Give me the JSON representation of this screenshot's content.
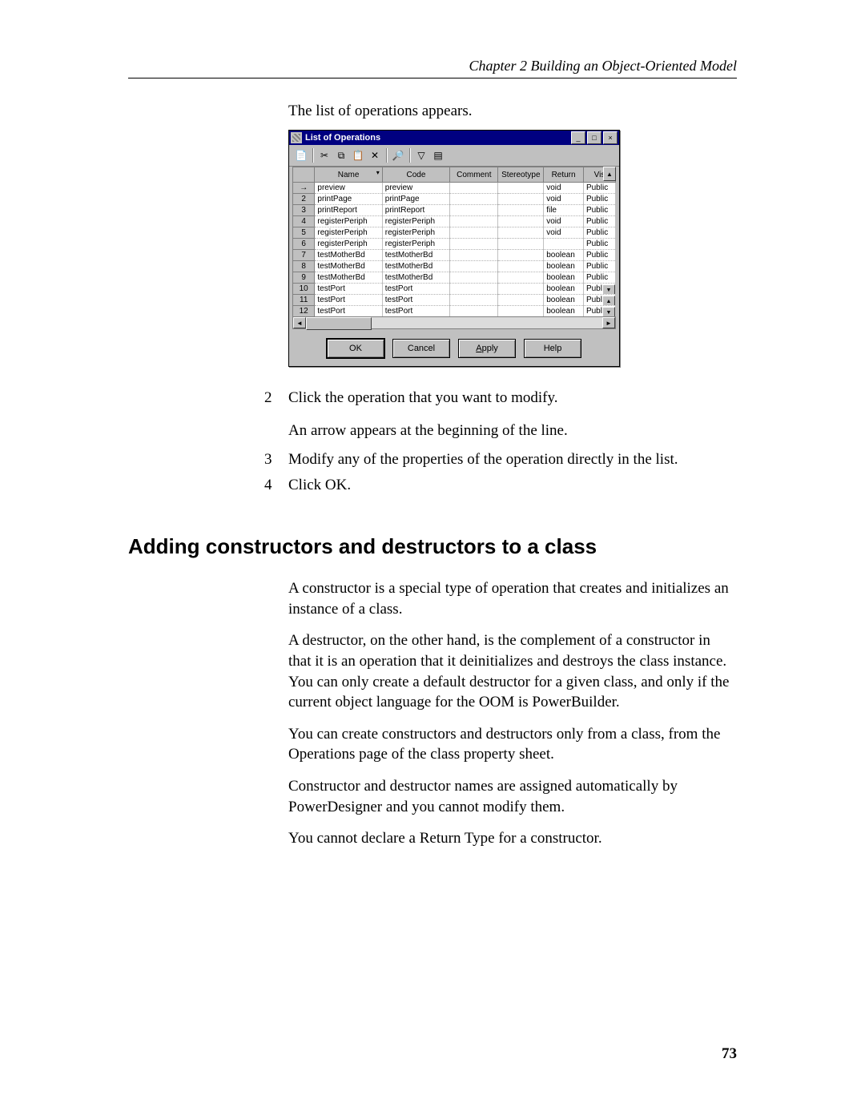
{
  "header": "Chapter 2   Building an Object-Oriented Model",
  "intro": "The list of operations appears.",
  "dialog": {
    "title": "List of Operations",
    "buttons": {
      "ok": "OK",
      "cancel": "Cancel",
      "apply": "Apply",
      "help": "Help"
    },
    "columns": {
      "name": "Name",
      "code": "Code",
      "comment": "Comment",
      "stereotype": "Stereotype",
      "return": "Return",
      "vis": "Vis"
    },
    "rows": [
      {
        "n": "→",
        "name": "preview",
        "code": "preview",
        "ret": "void",
        "vis": "Public",
        "arrow": true
      },
      {
        "n": "2",
        "name": "printPage",
        "code": "printPage",
        "ret": "void",
        "vis": "Public"
      },
      {
        "n": "3",
        "name": "printReport",
        "code": "printReport",
        "ret": "file",
        "vis": "Public"
      },
      {
        "n": "4",
        "name": "registerPeriph",
        "code": "registerPeriph",
        "ret": "void",
        "vis": "Public"
      },
      {
        "n": "5",
        "name": "registerPeriph",
        "code": "registerPeriph",
        "ret": "void",
        "vis": "Public"
      },
      {
        "n": "6",
        "name": "registerPeriph",
        "code": "registerPeriph",
        "ret": "",
        "vis": "Public"
      },
      {
        "n": "7",
        "name": "testMotherBd",
        "code": "testMotherBd",
        "ret": "boolean",
        "vis": "Public"
      },
      {
        "n": "8",
        "name": "testMotherBd",
        "code": "testMotherBd",
        "ret": "boolean",
        "vis": "Public"
      },
      {
        "n": "9",
        "name": "testMotherBd",
        "code": "testMotherBd",
        "ret": "boolean",
        "vis": "Public"
      },
      {
        "n": "10",
        "name": "testPort",
        "code": "testPort",
        "ret": "boolean",
        "vis": "Public"
      },
      {
        "n": "11",
        "name": "testPort",
        "code": "testPort",
        "ret": "boolean",
        "vis": "Public"
      },
      {
        "n": "12",
        "name": "testPort",
        "code": "testPort",
        "ret": "boolean",
        "vis": "Public"
      }
    ]
  },
  "steps": {
    "s2": "Click the operation that you want to modify.",
    "s2b": "An arrow appears at the beginning of the line.",
    "s3": "Modify any of the properties of the operation directly in the list.",
    "s4": "Click OK."
  },
  "section_heading": "Adding constructors and destructors to a class",
  "paragraphs": {
    "p1": "A constructor is a special type of operation that creates and initializes an instance of a class.",
    "p2": "A destructor, on the other hand, is the complement of a constructor in that it is an operation that it deinitializes and destroys the class instance. You can only create a default destructor for a given class, and only if the current object language for the OOM is PowerBuilder.",
    "p3": "You can create constructors and destructors only from a class, from the Operations page of the class property sheet.",
    "p4": "Constructor and destructor names are assigned automatically by PowerDesigner and you cannot modify them.",
    "p5": "You cannot declare a Return Type for a constructor."
  },
  "page_number": "73"
}
